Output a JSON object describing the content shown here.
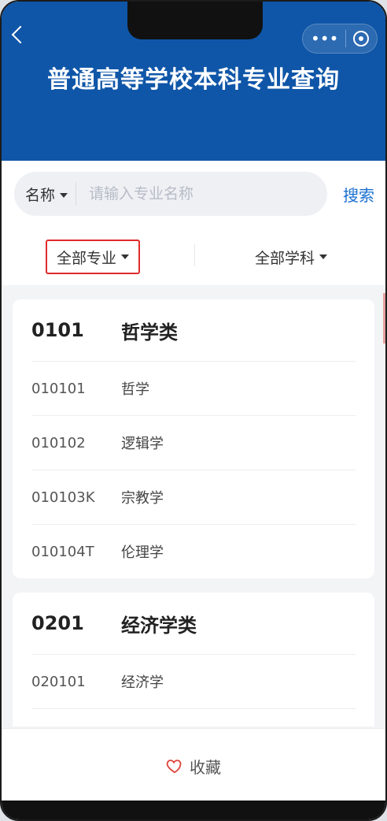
{
  "header": {
    "title": "普通高等学校本科专业查询"
  },
  "search": {
    "type_label": "名称",
    "placeholder": "请输入专业名称",
    "value": "",
    "button": "搜索"
  },
  "filters": {
    "major": "全部专业",
    "subject": "全部学科"
  },
  "categories": [
    {
      "code": "0101",
      "name": "哲学类",
      "items": [
        {
          "code": "010101",
          "name": "哲学"
        },
        {
          "code": "010102",
          "name": "逻辑学"
        },
        {
          "code": "010103K",
          "name": "宗教学"
        },
        {
          "code": "010104T",
          "name": "伦理学"
        }
      ]
    },
    {
      "code": "0201",
      "name": "经济学类",
      "items": [
        {
          "code": "020101",
          "name": "经济学"
        },
        {
          "code": "",
          "name": ""
        }
      ]
    }
  ],
  "bottom": {
    "favorite_label": "收藏"
  },
  "colors": {
    "header_bg": "#0f56a8",
    "accent": "#1a6fd1",
    "highlight": "#e02b2b"
  },
  "icons": {
    "back": "chevron-left-icon",
    "more": "more-dots-icon",
    "close": "target-close-icon",
    "dropdown": "triangle-down-icon",
    "favorite": "heart-icon"
  }
}
